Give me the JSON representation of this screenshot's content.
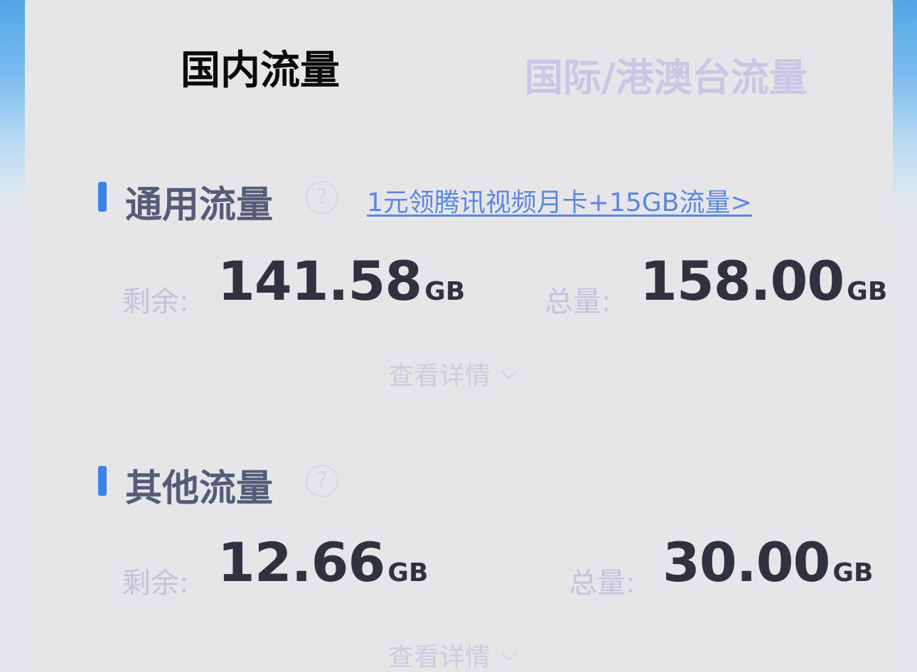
{
  "tabs": {
    "domestic": "国内流量",
    "international": "国际/港澳台流量"
  },
  "sections": [
    {
      "title": "通用流量",
      "help": "?",
      "promo": "1元领腾讯视频月卡+15GB流量>",
      "remaining_label": "剩余:",
      "remaining_value": "141.58",
      "remaining_unit": "GB",
      "total_label": "总量:",
      "total_value": "158.00",
      "total_unit": "GB",
      "details": "查看详情"
    },
    {
      "title": "其他流量",
      "help": "?",
      "remaining_label": "剩余:",
      "remaining_value": "12.66",
      "remaining_unit": "GB",
      "total_label": "总量:",
      "total_value": "30.00",
      "total_unit": "GB",
      "details": "查看详情"
    }
  ],
  "colors": {
    "accent_bar": "#3d82e6",
    "link": "#5c87df",
    "value_text": "#30323f",
    "muted_label": "#c4c2dc"
  }
}
